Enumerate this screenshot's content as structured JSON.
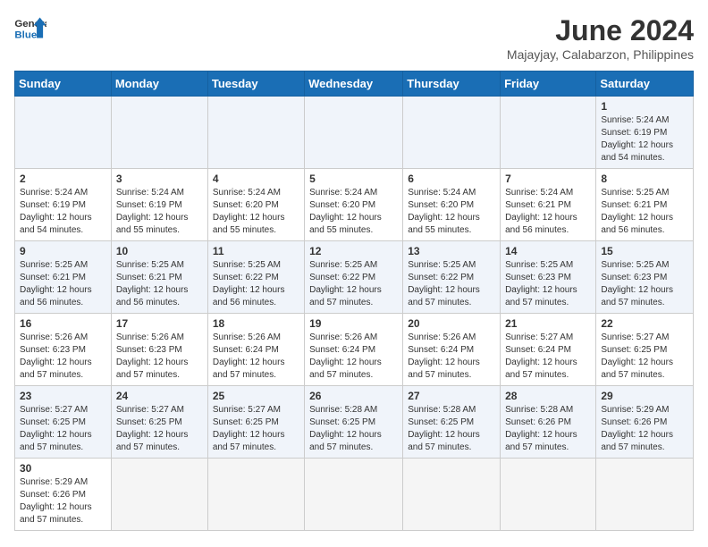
{
  "header": {
    "logo_general": "General",
    "logo_blue": "Blue",
    "month_year": "June 2024",
    "location": "Majayjay, Calabarzon, Philippines"
  },
  "weekdays": [
    "Sunday",
    "Monday",
    "Tuesday",
    "Wednesday",
    "Thursday",
    "Friday",
    "Saturday"
  ],
  "weeks": [
    [
      {
        "day": "",
        "info": ""
      },
      {
        "day": "",
        "info": ""
      },
      {
        "day": "",
        "info": ""
      },
      {
        "day": "",
        "info": ""
      },
      {
        "day": "",
        "info": ""
      },
      {
        "day": "",
        "info": ""
      },
      {
        "day": "1",
        "info": "Sunrise: 5:24 AM\nSunset: 6:19 PM\nDaylight: 12 hours\nand 54 minutes."
      }
    ],
    [
      {
        "day": "2",
        "info": "Sunrise: 5:24 AM\nSunset: 6:19 PM\nDaylight: 12 hours\nand 54 minutes."
      },
      {
        "day": "3",
        "info": "Sunrise: 5:24 AM\nSunset: 6:19 PM\nDaylight: 12 hours\nand 55 minutes."
      },
      {
        "day": "4",
        "info": "Sunrise: 5:24 AM\nSunset: 6:20 PM\nDaylight: 12 hours\nand 55 minutes."
      },
      {
        "day": "5",
        "info": "Sunrise: 5:24 AM\nSunset: 6:20 PM\nDaylight: 12 hours\nand 55 minutes."
      },
      {
        "day": "6",
        "info": "Sunrise: 5:24 AM\nSunset: 6:20 PM\nDaylight: 12 hours\nand 55 minutes."
      },
      {
        "day": "7",
        "info": "Sunrise: 5:24 AM\nSunset: 6:21 PM\nDaylight: 12 hours\nand 56 minutes."
      },
      {
        "day": "8",
        "info": "Sunrise: 5:25 AM\nSunset: 6:21 PM\nDaylight: 12 hours\nand 56 minutes."
      }
    ],
    [
      {
        "day": "9",
        "info": "Sunrise: 5:25 AM\nSunset: 6:21 PM\nDaylight: 12 hours\nand 56 minutes."
      },
      {
        "day": "10",
        "info": "Sunrise: 5:25 AM\nSunset: 6:21 PM\nDaylight: 12 hours\nand 56 minutes."
      },
      {
        "day": "11",
        "info": "Sunrise: 5:25 AM\nSunset: 6:22 PM\nDaylight: 12 hours\nand 56 minutes."
      },
      {
        "day": "12",
        "info": "Sunrise: 5:25 AM\nSunset: 6:22 PM\nDaylight: 12 hours\nand 57 minutes."
      },
      {
        "day": "13",
        "info": "Sunrise: 5:25 AM\nSunset: 6:22 PM\nDaylight: 12 hours\nand 57 minutes."
      },
      {
        "day": "14",
        "info": "Sunrise: 5:25 AM\nSunset: 6:23 PM\nDaylight: 12 hours\nand 57 minutes."
      },
      {
        "day": "15",
        "info": "Sunrise: 5:25 AM\nSunset: 6:23 PM\nDaylight: 12 hours\nand 57 minutes."
      }
    ],
    [
      {
        "day": "16",
        "info": "Sunrise: 5:26 AM\nSunset: 6:23 PM\nDaylight: 12 hours\nand 57 minutes."
      },
      {
        "day": "17",
        "info": "Sunrise: 5:26 AM\nSunset: 6:23 PM\nDaylight: 12 hours\nand 57 minutes."
      },
      {
        "day": "18",
        "info": "Sunrise: 5:26 AM\nSunset: 6:24 PM\nDaylight: 12 hours\nand 57 minutes."
      },
      {
        "day": "19",
        "info": "Sunrise: 5:26 AM\nSunset: 6:24 PM\nDaylight: 12 hours\nand 57 minutes."
      },
      {
        "day": "20",
        "info": "Sunrise: 5:26 AM\nSunset: 6:24 PM\nDaylight: 12 hours\nand 57 minutes."
      },
      {
        "day": "21",
        "info": "Sunrise: 5:27 AM\nSunset: 6:24 PM\nDaylight: 12 hours\nand 57 minutes."
      },
      {
        "day": "22",
        "info": "Sunrise: 5:27 AM\nSunset: 6:25 PM\nDaylight: 12 hours\nand 57 minutes."
      }
    ],
    [
      {
        "day": "23",
        "info": "Sunrise: 5:27 AM\nSunset: 6:25 PM\nDaylight: 12 hours\nand 57 minutes."
      },
      {
        "day": "24",
        "info": "Sunrise: 5:27 AM\nSunset: 6:25 PM\nDaylight: 12 hours\nand 57 minutes."
      },
      {
        "day": "25",
        "info": "Sunrise: 5:27 AM\nSunset: 6:25 PM\nDaylight: 12 hours\nand 57 minutes."
      },
      {
        "day": "26",
        "info": "Sunrise: 5:28 AM\nSunset: 6:25 PM\nDaylight: 12 hours\nand 57 minutes."
      },
      {
        "day": "27",
        "info": "Sunrise: 5:28 AM\nSunset: 6:25 PM\nDaylight: 12 hours\nand 57 minutes."
      },
      {
        "day": "28",
        "info": "Sunrise: 5:28 AM\nSunset: 6:26 PM\nDaylight: 12 hours\nand 57 minutes."
      },
      {
        "day": "29",
        "info": "Sunrise: 5:29 AM\nSunset: 6:26 PM\nDaylight: 12 hours\nand 57 minutes."
      }
    ],
    [
      {
        "day": "30",
        "info": "Sunrise: 5:29 AM\nSunset: 6:26 PM\nDaylight: 12 hours\nand 57 minutes."
      },
      {
        "day": "",
        "info": ""
      },
      {
        "day": "",
        "info": ""
      },
      {
        "day": "",
        "info": ""
      },
      {
        "day": "",
        "info": ""
      },
      {
        "day": "",
        "info": ""
      },
      {
        "day": "",
        "info": ""
      }
    ]
  ]
}
